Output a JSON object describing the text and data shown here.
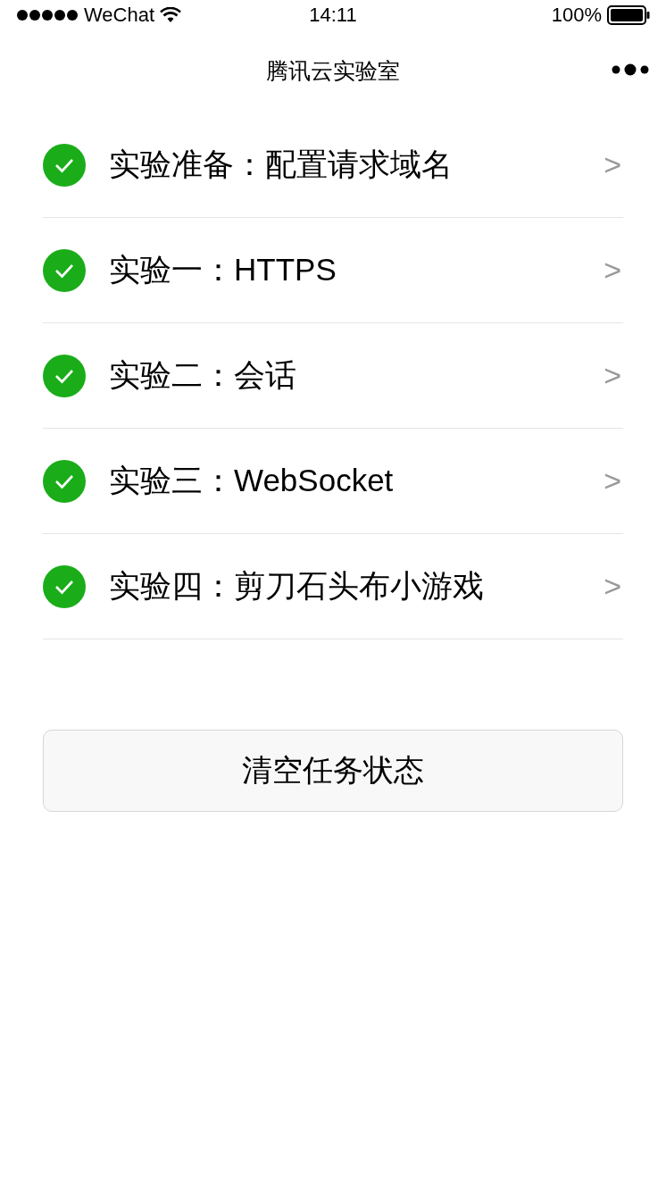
{
  "status_bar": {
    "carrier": "WeChat",
    "time": "14:11",
    "battery": "100%"
  },
  "nav": {
    "title": "腾讯云实验室"
  },
  "tasks": [
    {
      "label": "实验准备：配置请求域名",
      "done": true,
      "chevron": ">"
    },
    {
      "label": "实验一：HTTPS",
      "done": true,
      "chevron": ">"
    },
    {
      "label": "实验二：会话",
      "done": true,
      "chevron": ">"
    },
    {
      "label": "实验三：WebSocket",
      "done": true,
      "chevron": ">"
    },
    {
      "label": "实验四：剪刀石头布小游戏",
      "done": true,
      "chevron": ">"
    }
  ],
  "button": "清空任务状态"
}
